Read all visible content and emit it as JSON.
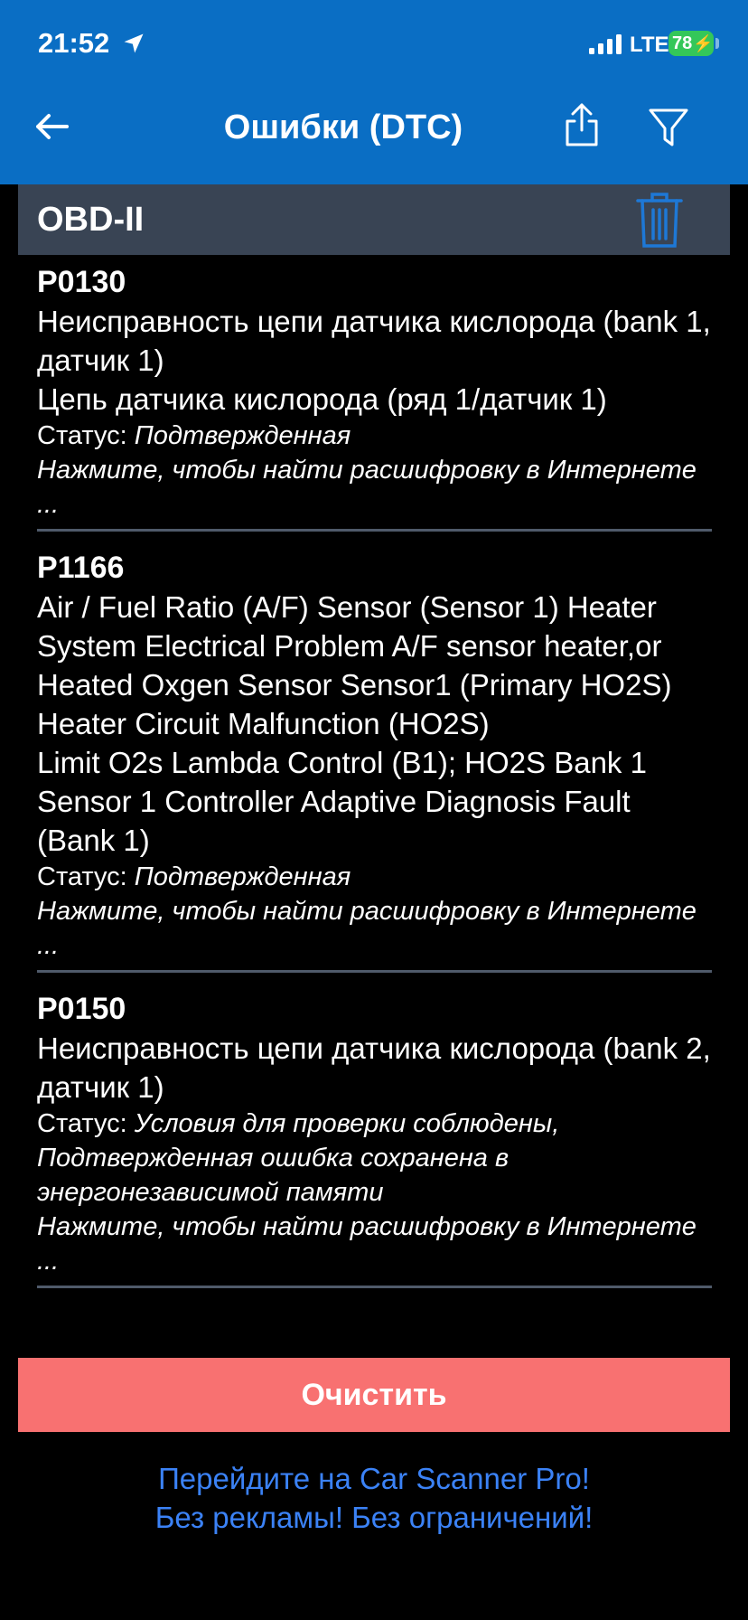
{
  "status_bar": {
    "time": "21:52",
    "network": "LTE",
    "battery": "78"
  },
  "nav": {
    "title": "Ошибки (DTC)"
  },
  "section": {
    "title": "OBD-II"
  },
  "errors": [
    {
      "code": "P0130",
      "descriptions": [
        "Неисправность цепи датчика кислорода (bank 1, датчик 1)",
        "Цепь датчика кислорода (ряд 1/датчик 1)"
      ],
      "status_label": "Статус:",
      "status_value": "Подтвержденная",
      "hint": "Нажмите, чтобы найти расшифровку в Интернете ..."
    },
    {
      "code": "P1166",
      "descriptions": [
        "Air / Fuel Ratio (A/F) Sensor (Sensor 1) Heater System Electrical Problem A/F sensor heater,or Heated Oxgen Sensor Sensor1 (Primary HO2S) Heater Circuit Malfunction (HO2S)",
        "Limit O2s Lambda Control (B1); HO2S Bank 1 Sensor 1 Controller Adaptive Diagnosis Fault (Bank 1)"
      ],
      "status_label": "Статус:",
      "status_value": "Подтвержденная",
      "hint": "Нажмите, чтобы найти расшифровку в Интернете ..."
    },
    {
      "code": "P0150",
      "descriptions": [
        "Неисправность цепи датчика кислорода (bank 2, датчик 1)"
      ],
      "status_label": "Статус:",
      "status_value": "Условия для проверки соблюдены, Подтвержденная ошибка сохранена в энергонезависимой памяти",
      "hint": "Нажмите, чтобы найти расшифровку в Интернете ..."
    }
  ],
  "clear_button": "Очистить",
  "promo": {
    "line1": "Перейдите на Car Scanner Pro!",
    "line2": "Без рекламы! Без ограничений!"
  },
  "colors": {
    "header_bg": "#0a6ec4",
    "section_bg": "#394454",
    "clear_button_bg": "#f87171",
    "promo_text": "#3b82f6",
    "battery_green": "#34c759"
  },
  "icons": {
    "back": "arrow-left-icon",
    "share": "share-icon",
    "filter": "filter-icon",
    "trash": "trash-icon",
    "location": "location-arrow-icon",
    "signal": "signal-bars-icon"
  }
}
